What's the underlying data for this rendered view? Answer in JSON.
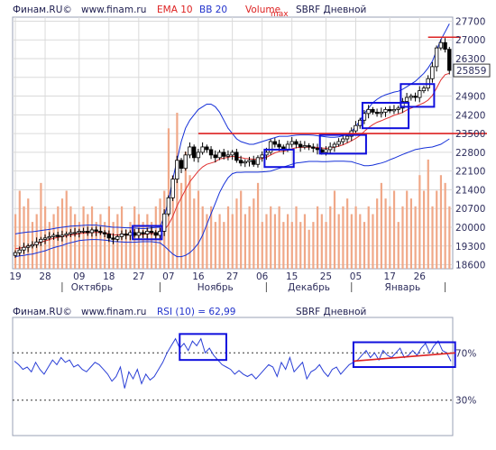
{
  "header": {
    "source": "Финам.RU©",
    "url": "www.finam.ru",
    "ema": "EMA 10",
    "bb": "BB 20",
    "volume": "Volume",
    "max": "max",
    "ticker": "SBRF Дневной"
  },
  "rsi_header": {
    "source": "Финам.RU©",
    "url": "www.finam.ru",
    "rsi": "RSI (10) = 62,99",
    "ticker": "SBRF Дневной"
  },
  "colors": {
    "bg": "#ffffff",
    "plot_bg": "#ffffff",
    "grid": "#dadada",
    "up_candle": "#ffffff",
    "down_candle": "#000000",
    "ema": "#e03030",
    "bb": "#1530d8",
    "volume": "#f0a888",
    "rsi": "#2a3fd6",
    "annotation_box": "#1010dd",
    "annotation_line": "#dd2222",
    "current_price_box": "#ffffff"
  },
  "chart_data": [
    {
      "type": "candlestick",
      "title": "SBRF Дневной",
      "current_price": 25859,
      "y_ticks": [
        18600,
        19300,
        20000,
        20700,
        21400,
        22100,
        22800,
        23500,
        24200,
        24900,
        25600,
        26300,
        27000,
        27700
      ],
      "y_tick_labels": [
        "18600",
        "19300",
        "20000",
        "20700",
        "21400",
        "22100",
        "22800",
        "23500",
        "24200",
        "24900",
        "",
        "26300",
        "27000",
        "27700"
      ],
      "ylim": [
        18450,
        27850
      ],
      "x_tick_labels": [
        "19",
        "28",
        "09",
        "18",
        "27",
        "07",
        "16",
        "27",
        "06",
        "15",
        "25",
        "05",
        "17",
        "26"
      ],
      "x_tick_positions": [
        0,
        7,
        15,
        22,
        29,
        36,
        43,
        51,
        58,
        65,
        73,
        80,
        88,
        95
      ],
      "month_labels": [
        {
          "label": "Октябрь",
          "at": 18
        },
        {
          "label": "Ноябрь",
          "at": 47
        },
        {
          "label": "Декабрь",
          "at": 69
        },
        {
          "label": "Январь",
          "at": 91
        }
      ],
      "month_separators": [
        11,
        34,
        59,
        79,
        101
      ],
      "closes": [
        19050,
        19150,
        19250,
        19300,
        19350,
        19450,
        19550,
        19600,
        19650,
        19700,
        19650,
        19700,
        19750,
        19800,
        19800,
        19850,
        19850,
        19800,
        19900,
        19850,
        19800,
        19750,
        19600,
        19550,
        19650,
        19750,
        19700,
        19800,
        19700,
        19800,
        19750,
        19850,
        19800,
        19700,
        19850,
        20500,
        21100,
        21800,
        22500,
        22200,
        22700,
        23000,
        22600,
        22800,
        23000,
        22900,
        22700,
        22600,
        22800,
        22650,
        22700,
        22800,
        22500,
        22400,
        22450,
        22500,
        22350,
        22600,
        22700,
        22800,
        23200,
        23100,
        23000,
        22900,
        23100,
        23200,
        23100,
        23000,
        23050,
        23000,
        22950,
        22900,
        22800,
        22900,
        23000,
        23100,
        23200,
        23300,
        23400,
        23600,
        23800,
        24000,
        24250,
        24400,
        24300,
        24250,
        24300,
        24400,
        24350,
        24400,
        24450,
        24700,
        24850,
        24900,
        24850,
        25100,
        25200,
        25550,
        26000,
        26700,
        26900,
        26650,
        25859
      ],
      "ema": [
        19200,
        19220,
        19250,
        19290,
        19330,
        19380,
        19440,
        19490,
        19540,
        19590,
        19620,
        19650,
        19680,
        19710,
        19730,
        19760,
        19780,
        19790,
        19800,
        19810,
        19800,
        19790,
        19760,
        19720,
        19710,
        19720,
        19720,
        19730,
        19720,
        19730,
        19730,
        19750,
        19770,
        19750,
        19760,
        19900,
        20100,
        20400,
        20800,
        21100,
        21400,
        21700,
        21900,
        22100,
        22250,
        22350,
        22400,
        22450,
        22550,
        22580,
        22610,
        22650,
        22620,
        22600,
        22570,
        22560,
        22540,
        22540,
        22570,
        22610,
        22700,
        22780,
        22830,
        22840,
        22880,
        22930,
        22970,
        22980,
        22990,
        22990,
        22990,
        22980,
        22960,
        22950,
        22960,
        22990,
        23030,
        23080,
        23150,
        23230,
        23320,
        23430,
        23580,
        23720,
        23830,
        23920,
        23980,
        24050,
        24110,
        24180,
        24230,
        24290,
        24380,
        24450,
        24510,
        24580,
        24650,
        24750,
        24920,
        25200,
        25500,
        25700,
        25750
      ],
      "bb_upper": [
        19750,
        19780,
        19800,
        19820,
        19830,
        19850,
        19880,
        19900,
        19920,
        19950,
        19980,
        20000,
        20020,
        20040,
        20050,
        20060,
        20070,
        20080,
        20080,
        20080,
        20060,
        20040,
        20020,
        20000,
        20000,
        19990,
        19980,
        19980,
        19970,
        19960,
        19950,
        19960,
        19980,
        19990,
        20000,
        20400,
        21000,
        21800,
        22500,
        23200,
        23700,
        24000,
        24200,
        24400,
        24500,
        24600,
        24600,
        24500,
        24300,
        24000,
        23700,
        23500,
        23300,
        23200,
        23150,
        23100,
        23100,
        23150,
        23200,
        23250,
        23300,
        23350,
        23400,
        23400,
        23400,
        23420,
        23440,
        23450,
        23450,
        23450,
        23440,
        23420,
        23400,
        23380,
        23360,
        23360,
        23380,
        23420,
        23480,
        23580,
        23750,
        24000,
        24250,
        24450,
        24650,
        24780,
        24880,
        24950,
        25000,
        25050,
        25080,
        25150,
        25250,
        25350,
        25450,
        25600,
        25750,
        25950,
        26200,
        26600,
        27000,
        27300,
        27600
      ],
      "bb_lower": [
        18900,
        18930,
        18950,
        18980,
        19000,
        19040,
        19080,
        19120,
        19180,
        19240,
        19280,
        19320,
        19380,
        19420,
        19460,
        19500,
        19520,
        19530,
        19540,
        19540,
        19530,
        19520,
        19500,
        19470,
        19460,
        19450,
        19440,
        19440,
        19440,
        19450,
        19460,
        19460,
        19460,
        19440,
        19420,
        19300,
        19150,
        19000,
        18900,
        18900,
        18950,
        19050,
        19200,
        19400,
        19700,
        20100,
        20500,
        20900,
        21300,
        21600,
        21850,
        22000,
        22050,
        22050,
        22060,
        22060,
        22060,
        22060,
        22070,
        22080,
        22100,
        22150,
        22200,
        22250,
        22300,
        22350,
        22400,
        22420,
        22440,
        22460,
        22460,
        22460,
        22450,
        22450,
        22460,
        22470,
        22470,
        22470,
        22460,
        22450,
        22400,
        22350,
        22300,
        22300,
        22320,
        22360,
        22400,
        22450,
        22520,
        22580,
        22650,
        22720,
        22780,
        22840,
        22900,
        22930,
        22960,
        22980,
        23000,
        23050,
        23100,
        23200,
        23300
      ],
      "volume": [
        0.35,
        0.5,
        0.4,
        0.45,
        0.3,
        0.35,
        0.55,
        0.4,
        0.3,
        0.35,
        0.4,
        0.45,
        0.5,
        0.4,
        0.35,
        0.3,
        0.4,
        0.35,
        0.4,
        0.3,
        0.35,
        0.3,
        0.4,
        0.3,
        0.35,
        0.4,
        0.25,
        0.3,
        0.4,
        0.35,
        0.3,
        0.35,
        0.3,
        0.4,
        0.45,
        0.5,
        0.9,
        0.6,
        1.0,
        0.55,
        0.75,
        0.6,
        0.45,
        0.5,
        0.4,
        0.35,
        0.4,
        0.3,
        0.35,
        0.3,
        0.4,
        0.35,
        0.45,
        0.5,
        0.35,
        0.4,
        0.45,
        0.55,
        0.3,
        0.35,
        0.4,
        0.35,
        0.4,
        0.3,
        0.35,
        0.3,
        0.4,
        0.3,
        0.35,
        0.25,
        0.3,
        0.4,
        0.35,
        0.3,
        0.4,
        0.5,
        0.35,
        0.4,
        0.45,
        0.35,
        0.4,
        0.35,
        0.3,
        0.4,
        0.35,
        0.45,
        0.55,
        0.45,
        0.4,
        0.5,
        0.3,
        0.4,
        0.5,
        0.45,
        0.4,
        0.6,
        0.5,
        0.7,
        0.4,
        0.5,
        0.6,
        0.55,
        0.4
      ],
      "resistance_lines": [
        23500,
        27100
      ],
      "boxes": [
        {
          "i0": 28,
          "i1": 34,
          "p0": 19550,
          "p1": 20050
        },
        {
          "i0": 59,
          "i1": 65,
          "p0": 22250,
          "p1": 22900
        },
        {
          "i0": 72,
          "i1": 82,
          "p0": 22750,
          "p1": 23450
        },
        {
          "i0": 82,
          "i1": 92,
          "p0": 23700,
          "p1": 24650
        },
        {
          "i0": 91,
          "i1": 98,
          "p0": 24500,
          "p1": 25350
        }
      ]
    },
    {
      "type": "line",
      "title": "RSI (10) = 62,99",
      "ylim": [
        0,
        100
      ],
      "levels": [
        70,
        30
      ],
      "y_tick_labels": [
        "70%",
        "30%"
      ],
      "values": [
        63,
        60,
        56,
        58,
        54,
        62,
        56,
        52,
        58,
        64,
        60,
        66,
        62,
        64,
        58,
        60,
        56,
        54,
        58,
        62,
        60,
        56,
        52,
        46,
        50,
        58,
        40,
        54,
        48,
        56,
        44,
        52,
        47,
        50,
        56,
        62,
        70,
        76,
        82,
        74,
        78,
        72,
        80,
        76,
        82,
        70,
        74,
        68,
        64,
        60,
        58,
        56,
        52,
        55,
        52,
        50,
        52,
        48,
        52,
        56,
        60,
        58,
        50,
        62,
        56,
        66,
        54,
        58,
        62,
        48,
        54,
        56,
        60,
        54,
        50,
        56,
        58,
        52,
        56,
        60,
        62,
        64,
        68,
        72,
        66,
        70,
        64,
        72,
        68,
        66,
        70,
        74,
        66,
        68,
        72,
        68,
        74,
        78,
        70,
        76,
        80,
        72,
        70,
        63
      ],
      "boxes": [
        {
          "i0": 39,
          "i1": 50,
          "r0": 64,
          "r1": 86
        },
        {
          "i0": 80,
          "i1": 104,
          "r0": 58,
          "r1": 79
        }
      ],
      "trend_line": {
        "i0": 80,
        "r0": 63,
        "i1": 104,
        "r1": 70
      }
    }
  ]
}
